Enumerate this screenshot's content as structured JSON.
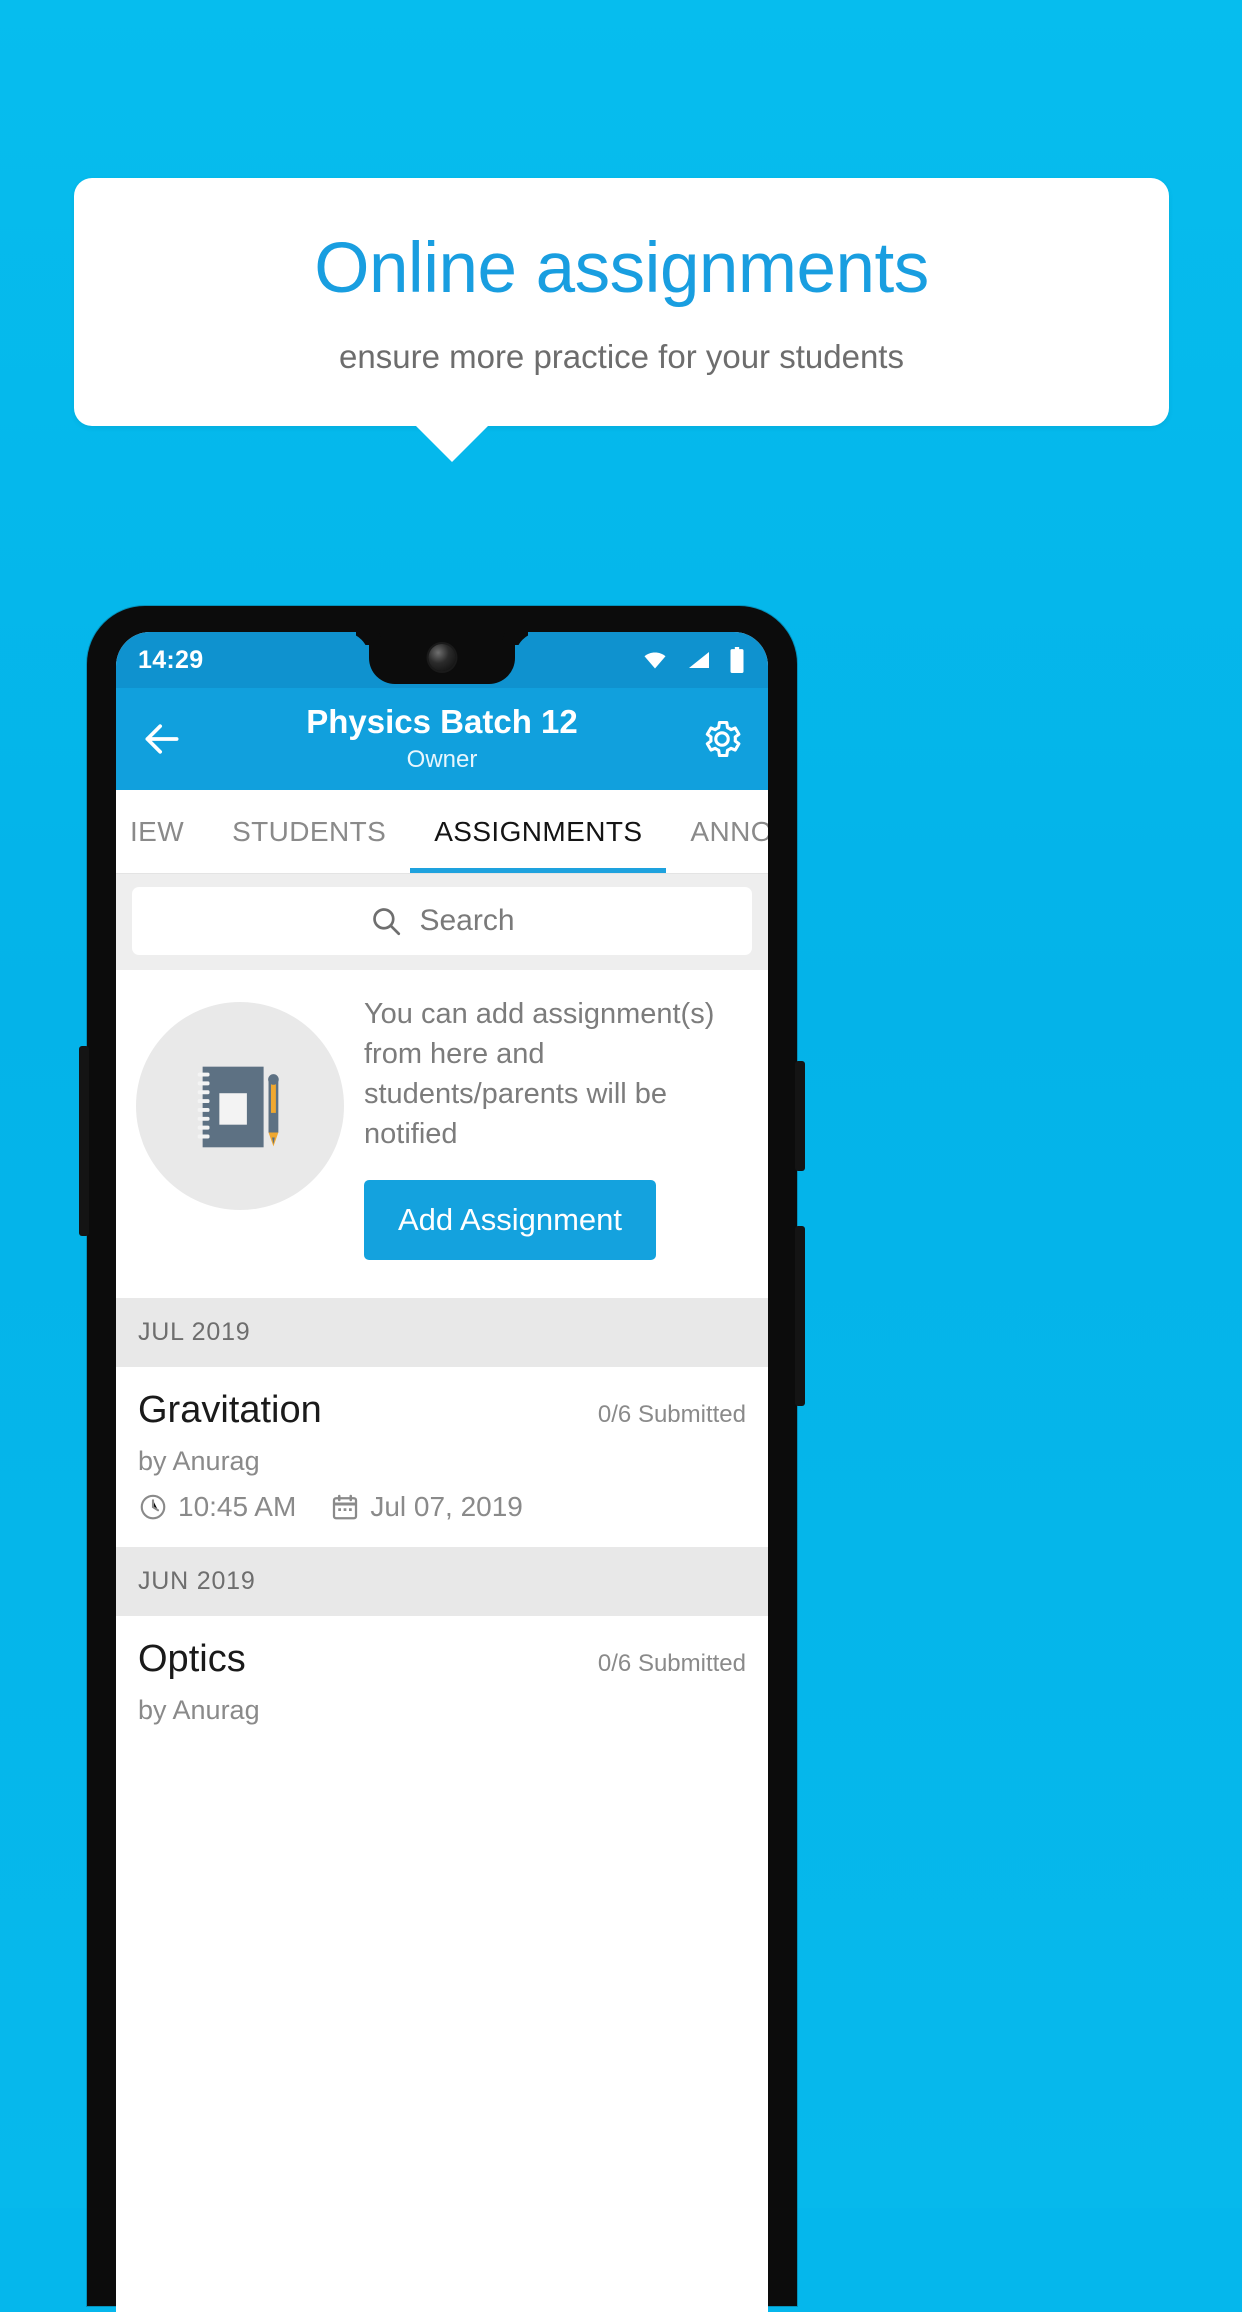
{
  "promo": {
    "title": "Online assignments",
    "subtitle": "ensure more practice for your students",
    "accent_color": "#199ee0",
    "background_color": "#05b7ec"
  },
  "phone": {
    "status_bar": {
      "time": "14:29",
      "icons": [
        "wifi-icon",
        "cellular-signal-icon",
        "battery-icon"
      ]
    },
    "app_bar": {
      "back_icon": "back-arrow-icon",
      "title": "Physics Batch 12",
      "subtitle": "Owner",
      "settings_icon": "gear-icon",
      "background_color": "#11a0dd"
    },
    "tabs": [
      {
        "label": "IEW",
        "active": false
      },
      {
        "label": "STUDENTS",
        "active": false
      },
      {
        "label": "ASSIGNMENTS",
        "active": true
      },
      {
        "label": "ANNOUNCEM",
        "active": false
      }
    ],
    "search": {
      "placeholder": "Search",
      "value": "",
      "icon": "search-icon"
    },
    "empty_state": {
      "illustration": "notebook-and-pen-icon",
      "text": "You can add assignment(s) from here and students/parents will be notified",
      "button_label": "Add Assignment",
      "button_color": "#14a2de"
    },
    "sections": [
      {
        "month": "JUL 2019",
        "assignments": [
          {
            "title": "Gravitation",
            "submitted": "0/6 Submitted",
            "author": "by Anurag",
            "time": "10:45 AM",
            "date": "Jul 07, 2019",
            "clock_icon": "clock-icon",
            "calendar_icon": "calendar-icon"
          }
        ]
      },
      {
        "month": "JUN 2019",
        "assignments": [
          {
            "title": "Optics",
            "submitted": "0/6 Submitted",
            "author": "by Anurag",
            "time": "",
            "date": "",
            "clock_icon": "clock-icon",
            "calendar_icon": "calendar-icon"
          }
        ]
      }
    ]
  }
}
